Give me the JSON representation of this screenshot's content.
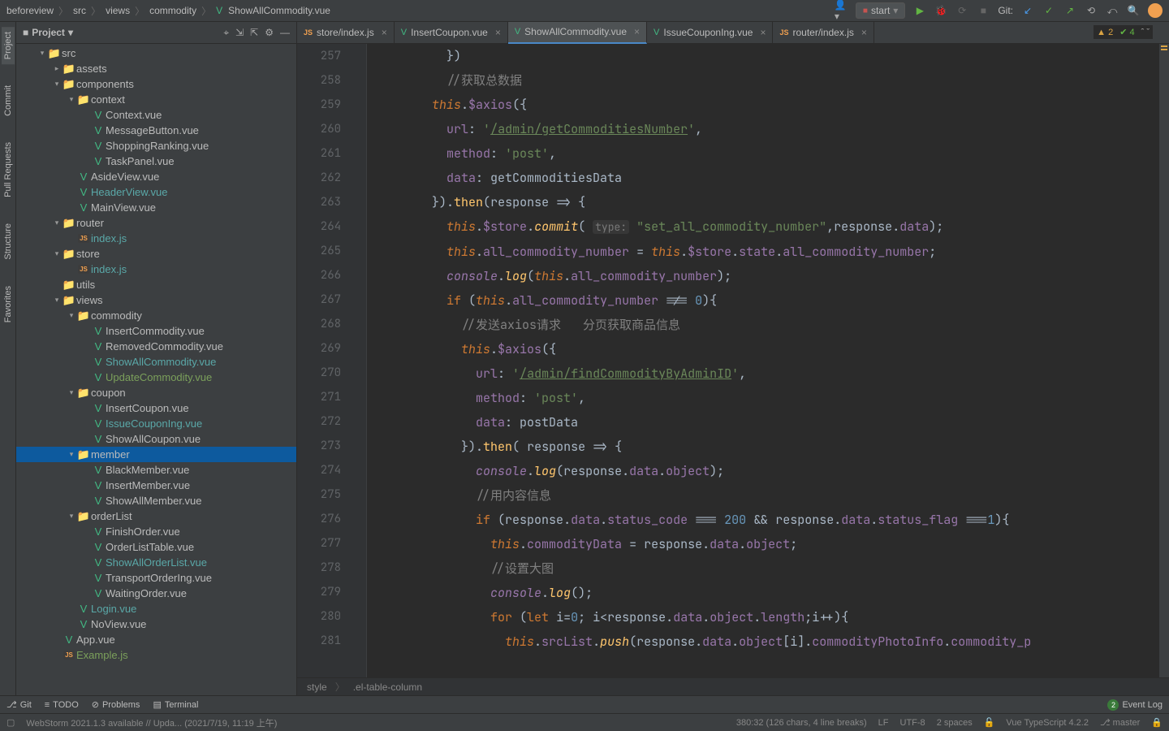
{
  "breadcrumb": [
    "beforeview",
    "src",
    "views",
    "commodity",
    "ShowAllCommodity.vue"
  ],
  "runConfig": "start",
  "gitLabel": "Git:",
  "projectPanel": {
    "title": "Project",
    "tree": [
      {
        "depth": 1,
        "arrow": "▾",
        "type": "folder",
        "name": "src"
      },
      {
        "depth": 2,
        "arrow": "▸",
        "type": "folder",
        "name": "assets"
      },
      {
        "depth": 2,
        "arrow": "▾",
        "type": "folder",
        "name": "components"
      },
      {
        "depth": 3,
        "arrow": "▾",
        "type": "folder",
        "name": "context"
      },
      {
        "depth": 4,
        "arrow": "",
        "type": "vue",
        "name": "Context.vue"
      },
      {
        "depth": 4,
        "arrow": "",
        "type": "vue",
        "name": "MessageButton.vue"
      },
      {
        "depth": 4,
        "arrow": "",
        "type": "vue",
        "name": "ShoppingRanking.vue"
      },
      {
        "depth": 4,
        "arrow": "",
        "type": "vue",
        "name": "TaskPanel.vue"
      },
      {
        "depth": 3,
        "arrow": "",
        "type": "vue",
        "name": "AsideView.vue"
      },
      {
        "depth": 3,
        "arrow": "",
        "type": "vue",
        "name": "HeaderView.vue",
        "teal": true
      },
      {
        "depth": 3,
        "arrow": "",
        "type": "vue",
        "name": "MainView.vue"
      },
      {
        "depth": 2,
        "arrow": "▾",
        "type": "folder",
        "name": "router"
      },
      {
        "depth": 3,
        "arrow": "",
        "type": "js",
        "name": "index.js",
        "teal": true
      },
      {
        "depth": 2,
        "arrow": "▾",
        "type": "folder",
        "name": "store"
      },
      {
        "depth": 3,
        "arrow": "",
        "type": "js",
        "name": "index.js",
        "teal": true
      },
      {
        "depth": 2,
        "arrow": "",
        "type": "folder",
        "name": "utils"
      },
      {
        "depth": 2,
        "arrow": "▾",
        "type": "folder",
        "name": "views"
      },
      {
        "depth": 3,
        "arrow": "▾",
        "type": "folder",
        "name": "commodity"
      },
      {
        "depth": 4,
        "arrow": "",
        "type": "vue",
        "name": "InsertCommodity.vue"
      },
      {
        "depth": 4,
        "arrow": "",
        "type": "vue",
        "name": "RemovedCommodity.vue"
      },
      {
        "depth": 4,
        "arrow": "",
        "type": "vue",
        "name": "ShowAllCommodity.vue",
        "teal": true
      },
      {
        "depth": 4,
        "arrow": "",
        "type": "vue",
        "name": "UpdateCommodity.vue",
        "green": true
      },
      {
        "depth": 3,
        "arrow": "▾",
        "type": "folder",
        "name": "coupon"
      },
      {
        "depth": 4,
        "arrow": "",
        "type": "vue",
        "name": "InsertCoupon.vue"
      },
      {
        "depth": 4,
        "arrow": "",
        "type": "vue",
        "name": "IssueCouponIng.vue",
        "teal": true
      },
      {
        "depth": 4,
        "arrow": "",
        "type": "vue",
        "name": "ShowAllCoupon.vue"
      },
      {
        "depth": 3,
        "arrow": "▾",
        "type": "folder",
        "name": "member",
        "selected": true
      },
      {
        "depth": 4,
        "arrow": "",
        "type": "vue",
        "name": "BlackMember.vue"
      },
      {
        "depth": 4,
        "arrow": "",
        "type": "vue",
        "name": "InsertMember.vue"
      },
      {
        "depth": 4,
        "arrow": "",
        "type": "vue",
        "name": "ShowAllMember.vue"
      },
      {
        "depth": 3,
        "arrow": "▾",
        "type": "folder",
        "name": "orderList"
      },
      {
        "depth": 4,
        "arrow": "",
        "type": "vue",
        "name": "FinishOrder.vue"
      },
      {
        "depth": 4,
        "arrow": "",
        "type": "vue",
        "name": "OrderListTable.vue"
      },
      {
        "depth": 4,
        "arrow": "",
        "type": "vue",
        "name": "ShowAllOrderList.vue",
        "teal": true
      },
      {
        "depth": 4,
        "arrow": "",
        "type": "vue",
        "name": "TransportOrderIng.vue"
      },
      {
        "depth": 4,
        "arrow": "",
        "type": "vue",
        "name": "WaitingOrder.vue"
      },
      {
        "depth": 3,
        "arrow": "",
        "type": "vue",
        "name": "Login.vue",
        "teal": true
      },
      {
        "depth": 3,
        "arrow": "",
        "type": "vue",
        "name": "NoView.vue"
      },
      {
        "depth": 2,
        "arrow": "",
        "type": "vue",
        "name": "App.vue"
      },
      {
        "depth": 2,
        "arrow": "",
        "type": "js",
        "name": "Example.js",
        "green": true
      }
    ]
  },
  "tabs": [
    {
      "icon": "js",
      "label": "store/index.js",
      "active": false
    },
    {
      "icon": "vue",
      "label": "InsertCoupon.vue",
      "active": false
    },
    {
      "icon": "vue",
      "label": "ShowAllCommodity.vue",
      "active": true
    },
    {
      "icon": "vue",
      "label": "IssueCouponIng.vue",
      "active": false
    },
    {
      "icon": "js",
      "label": "router/index.js",
      "active": false
    }
  ],
  "inspections": {
    "warnings": "2",
    "typos": "4",
    "nav": "ˆ  ˇ"
  },
  "lineStart": 257,
  "lineCount": 25,
  "codeLines": [
    "          <span class='op'>})</span>",
    "          <span class='cm'>//获取总数据</span>",
    "        <span class='th'>this</span><span class='op'>.</span><span class='prop'>$axios</span><span class='op'>({</span>",
    "          <span class='prop'>url</span><span class='op'>: </span><span class='str'>'</span><span class='url'>/admin/getCommoditiesNumber</span><span class='str'>'</span><span class='op'>,</span>",
    "          <span class='prop'>method</span><span class='op'>: </span><span class='str'>'post'</span><span class='op'>,</span>",
    "          <span class='prop'>data</span><span class='op'>: </span><span class='ident'>getCommoditiesData</span>",
    "        <span class='op'>}).</span><span class='fnn'>then</span><span class='op'>(</span><span class='ident'>response</span> <span class='op'>=&gt; {</span>",
    "          <span class='th'>this</span><span class='op'>.</span><span class='prop'>$store</span><span class='op'>.</span><span class='fn'>commit</span><span class='op'>( </span><span class='hint'>type:</span> <span class='str'>\"set_all_commodity_number\"</span><span class='op'>,</span><span class='ident'>response</span><span class='op'>.</span><span class='prop'>data</span><span class='op'>);</span>",
    "          <span class='th'>this</span><span class='op'>.</span><span class='prop'>all_commodity_number</span> <span class='op'>=</span> <span class='th'>this</span><span class='op'>.</span><span class='prop'>$store</span><span class='op'>.</span><span class='prop'>state</span><span class='op'>.</span><span class='prop'>all_commodity_number</span><span class='op'>;</span>",
    "          <span class='con'>console</span><span class='op'>.</span><span class='fn'>log</span><span class='op'>(</span><span class='th'>this</span><span class='op'>.</span><span class='prop'>all_commodity_number</span><span class='op'>);</span>",
    "          <span class='kw'>if </span><span class='op'>(</span><span class='th'>this</span><span class='op'>.</span><span class='prop'>all_commodity_number</span> <span class='op'>!==</span> <span class='num'>0</span><span class='op'>){</span>",
    "            <span class='cm'>//发送axios请求   分页获取商品信息</span>",
    "            <span class='th'>this</span><span class='op'>.</span><span class='prop'>$axios</span><span class='op'>({</span>",
    "              <span class='prop'>url</span><span class='op'>: </span><span class='str'>'</span><span class='url'>/admin/findCommodityByAdminID</span><span class='str'>'</span><span class='op'>,</span>",
    "              <span class='prop'>method</span><span class='op'>: </span><span class='str'>'post'</span><span class='op'>,</span>",
    "              <span class='prop'>data</span><span class='op'>: </span><span class='ident'>postData</span>",
    "            <span class='op'>}).</span><span class='fnn'>then</span><span class='op'>( </span><span class='ident'>response</span> <span class='op'>=&gt; {</span>",
    "              <span class='con'>console</span><span class='op'>.</span><span class='fn'>log</span><span class='op'>(</span><span class='ident'>response</span><span class='op'>.</span><span class='prop'>data</span><span class='op'>.</span><span class='prop'>object</span><span class='op'>);</span>",
    "              <span class='cm'>//用内容信息</span>",
    "              <span class='kw'>if </span><span class='op'>(</span><span class='ident'>response</span><span class='op'>.</span><span class='prop'>data</span><span class='op'>.</span><span class='prop'>status_code</span> <span class='op'>===</span> <span class='num'>200</span> <span class='op'>&amp;&amp;</span> <span class='ident'>response</span><span class='op'>.</span><span class='prop'>data</span><span class='op'>.</span><span class='prop'>status_flag</span> <span class='op'>===</span><span class='num'>1</span><span class='op'>){</span>",
    "                <span class='th'>this</span><span class='op'>.</span><span class='prop'>commodityData</span> <span class='op'>=</span> <span class='ident'>response</span><span class='op'>.</span><span class='prop'>data</span><span class='op'>.</span><span class='prop'>object</span><span class='op'>;</span>",
    "                <span class='cm'>//设置大图</span>",
    "                <span class='con'>console</span><span class='op'>.</span><span class='fn'>log</span><span class='op'>();</span>",
    "                <span class='kw'>for </span><span class='op'>(</span><span class='kw'>let </span><span class='ident'>i</span><span class='op'>=</span><span class='num'>0</span><span class='op'>; </span><span class='ident'>i</span><span class='op'>&lt;</span><span class='ident'>response</span><span class='op'>.</span><span class='prop'>data</span><span class='op'>.</span><span class='prop'>object</span><span class='op'>.</span><span class='prop'>length</span><span class='op'>;</span><span class='ident'>i</span><span class='op'>++){</span>",
    "                  <span class='th'>this</span><span class='op'>.</span><span class='prop'>srcList</span><span class='op'>.</span><span class='fn'>push</span><span class='op'>(</span><span class='ident'>response</span><span class='op'>.</span><span class='prop'>data</span><span class='op'>.</span><span class='prop'>object</span><span class='op'>[</span><span class='ident'>i</span><span class='op'>].</span><span class='prop'>commodityPhotoInfo</span><span class='op'>.</span><span class='prop'>commodity_p</span>"
  ],
  "editorBreadcrumb": [
    "style",
    ".el-table-column"
  ],
  "bottomTools": {
    "git": "Git",
    "todo": "TODO",
    "problems": "Problems",
    "terminal": "Terminal",
    "eventLog": "Event Log",
    "eventBadge": "2"
  },
  "statusBar": {
    "msg": "WebStorm 2021.1.3 available // Upda... (2021/7/19, 11:19 上午)",
    "pos": "380:32 (126 chars, 4 line breaks)",
    "lineSep": "LF",
    "encoding": "UTF-8",
    "indent": "2 spaces",
    "lang": "Vue TypeScript 4.2.2",
    "branch": "master"
  },
  "leftGutter": [
    "Project",
    "Commit",
    "Pull Requests",
    "Structure",
    "Favorites"
  ]
}
